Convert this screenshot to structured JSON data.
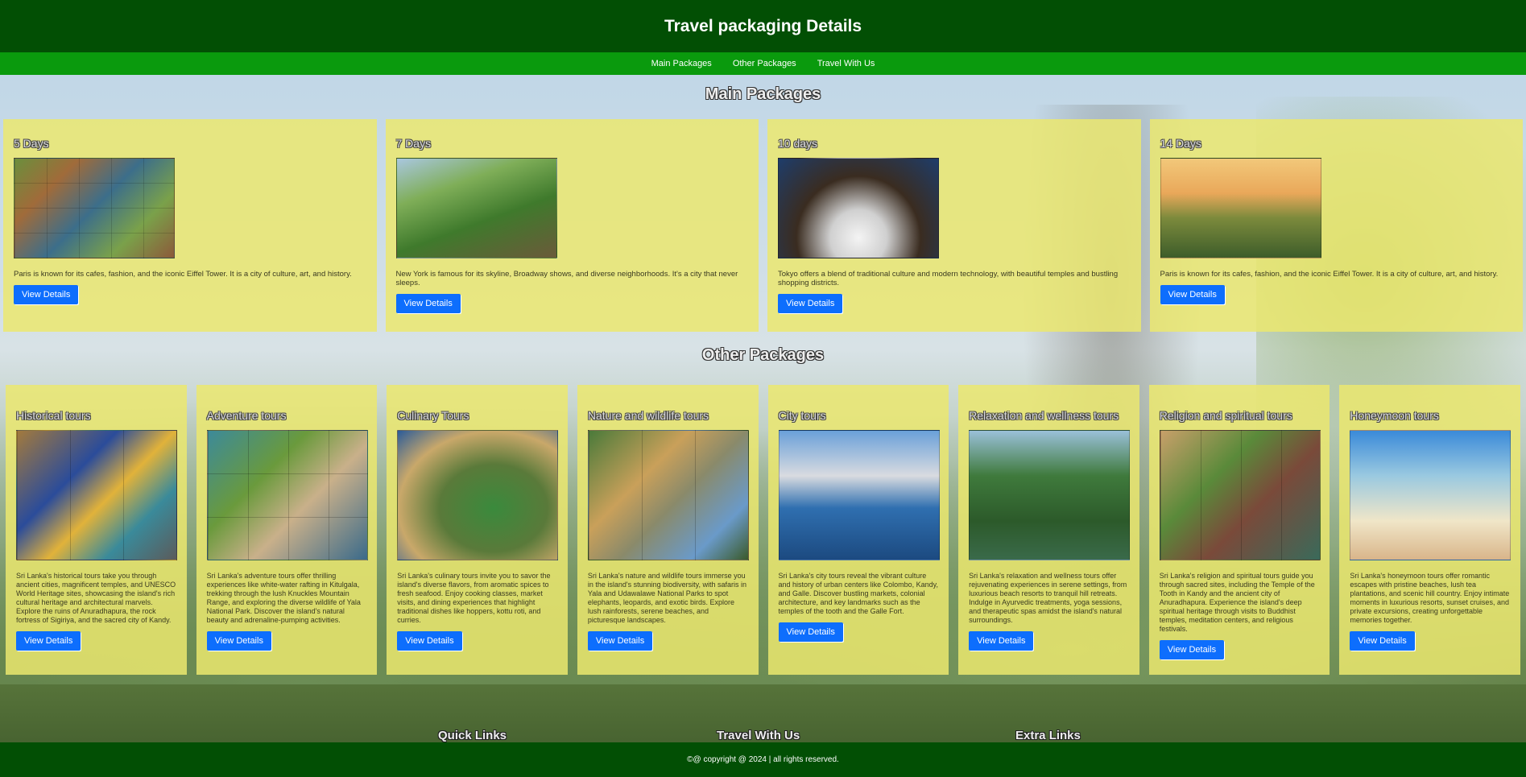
{
  "header": {
    "title": "Travel packaging Details"
  },
  "nav": [
    {
      "label": "Main Packages"
    },
    {
      "label": "Other Packages"
    },
    {
      "label": "Travel With Us"
    }
  ],
  "sections": {
    "main_title": "Main Packages",
    "other_title": "Other Packages"
  },
  "main_packages": [
    {
      "title": "5 Days",
      "text": "Paris is known for its cafes, fashion, and the iconic Eiffel Tower. It is a city of culture, art, and history.",
      "button": "View Details"
    },
    {
      "title": "7 Days",
      "text": "New York is famous for its skyline, Broadway shows, and diverse neighborhoods. It's a city that never sleeps.",
      "button": "View Details"
    },
    {
      "title": "10 days",
      "text": "Tokyo offers a blend of traditional culture and modern technology, with beautiful temples and bustling shopping districts.",
      "button": "View Details"
    },
    {
      "title": "14 Days",
      "text": "Paris is known for its cafes, fashion, and the iconic Eiffel Tower. It is a city of culture, art, and history.",
      "button": "View Details"
    }
  ],
  "other_packages": [
    {
      "title": "Historical tours",
      "text": "Sri Lanka's historical tours take you through ancient cities, magnificent temples, and UNESCO World Heritage sites, showcasing the island's rich cultural heritage and architectural marvels. Explore the ruins of Anuradhapura, the rock fortress of Sigiriya, and the sacred city of Kandy.",
      "button": "View Details"
    },
    {
      "title": "Adventure tours",
      "text": "Sri Lanka's adventure tours offer thrilling experiences like white-water rafting in Kitulgala, trekking through the lush Knuckles Mountain Range, and exploring the diverse wildlife of Yala National Park. Discover the island's natural beauty and adrenaline-pumping activities.",
      "button": "View Details"
    },
    {
      "title": "Culinary Tours",
      "text": "Sri Lanka's culinary tours invite you to savor the island's diverse flavors, from aromatic spices to fresh seafood. Enjoy cooking classes, market visits, and dining experiences that highlight traditional dishes like hoppers, kottu roti, and curries.",
      "button": "View Details"
    },
    {
      "title": "Nature and wildlife tours",
      "text": "Sri Lanka's nature and wildlife tours immerse you in the island's stunning biodiversity, with safaris in Yala and Udawalawe National Parks to spot elephants, leopards, and exotic birds. Explore lush rainforests, serene beaches, and picturesque landscapes.",
      "button": "View Details"
    },
    {
      "title": "City tours",
      "text": "Sri Lanka's city tours reveal the vibrant culture and history of urban centers like Colombo, Kandy, and Galle. Discover bustling markets, colonial architecture, and key landmarks such as the temples of the tooth and the Galle Fort.",
      "button": "View Details"
    },
    {
      "title": "Relaxation and wellness tours",
      "text": "Sri Lanka's relaxation and wellness tours offer rejuvenating experiences in serene settings, from luxurious beach resorts to tranquil hill retreats. Indulge in Ayurvedic treatments, yoga sessions, and therapeutic spas amidst the island's natural surroundings.",
      "button": "View Details"
    },
    {
      "title": "Religion and spiritual tours",
      "text": "Sri Lanka's religion and spiritual tours guide you through sacred sites, including the Temple of the Tooth in Kandy and the ancient city of Anuradhapura. Experience the island's deep spiritual heritage through visits to Buddhist temples, meditation centers, and religious festivals.",
      "button": "View Details"
    },
    {
      "title": "Honeymoon tours",
      "text": "Sri Lanka's honeymoon tours offer romantic escapes with pristine beaches, lush tea plantations, and scenic hill country. Enjoy intimate moments in luxurious resorts, sunset cruises, and private excursions, creating unforgettable memories together.",
      "button": "View Details"
    }
  ],
  "footer": {
    "headings": [
      "Quick Links",
      "Travel With Us",
      "Extra Links"
    ],
    "copyright": "©@ copyright @ 2024 | all rights reserved."
  }
}
